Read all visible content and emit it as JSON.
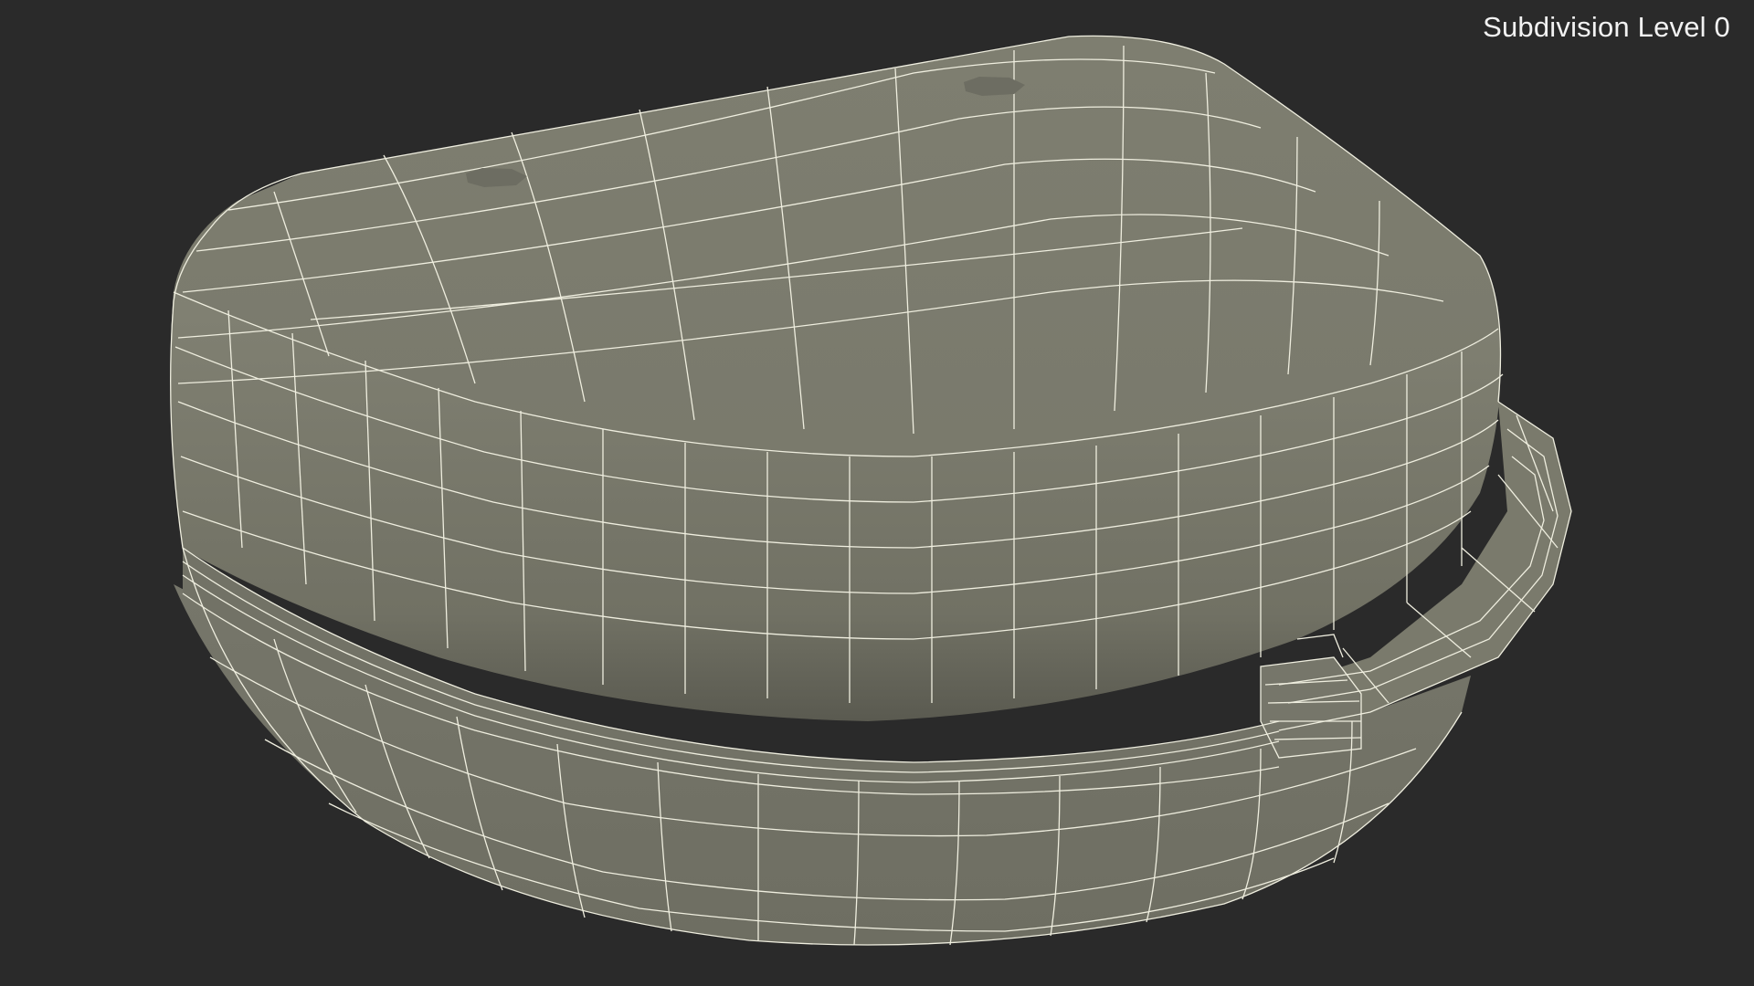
{
  "viewport": {
    "label": "Subdivision Level 0",
    "background_color": "#2a2a2a",
    "model_color": "#7b7b6c",
    "wire_color": "#efeedf",
    "object": "retainer-case-mesh"
  }
}
